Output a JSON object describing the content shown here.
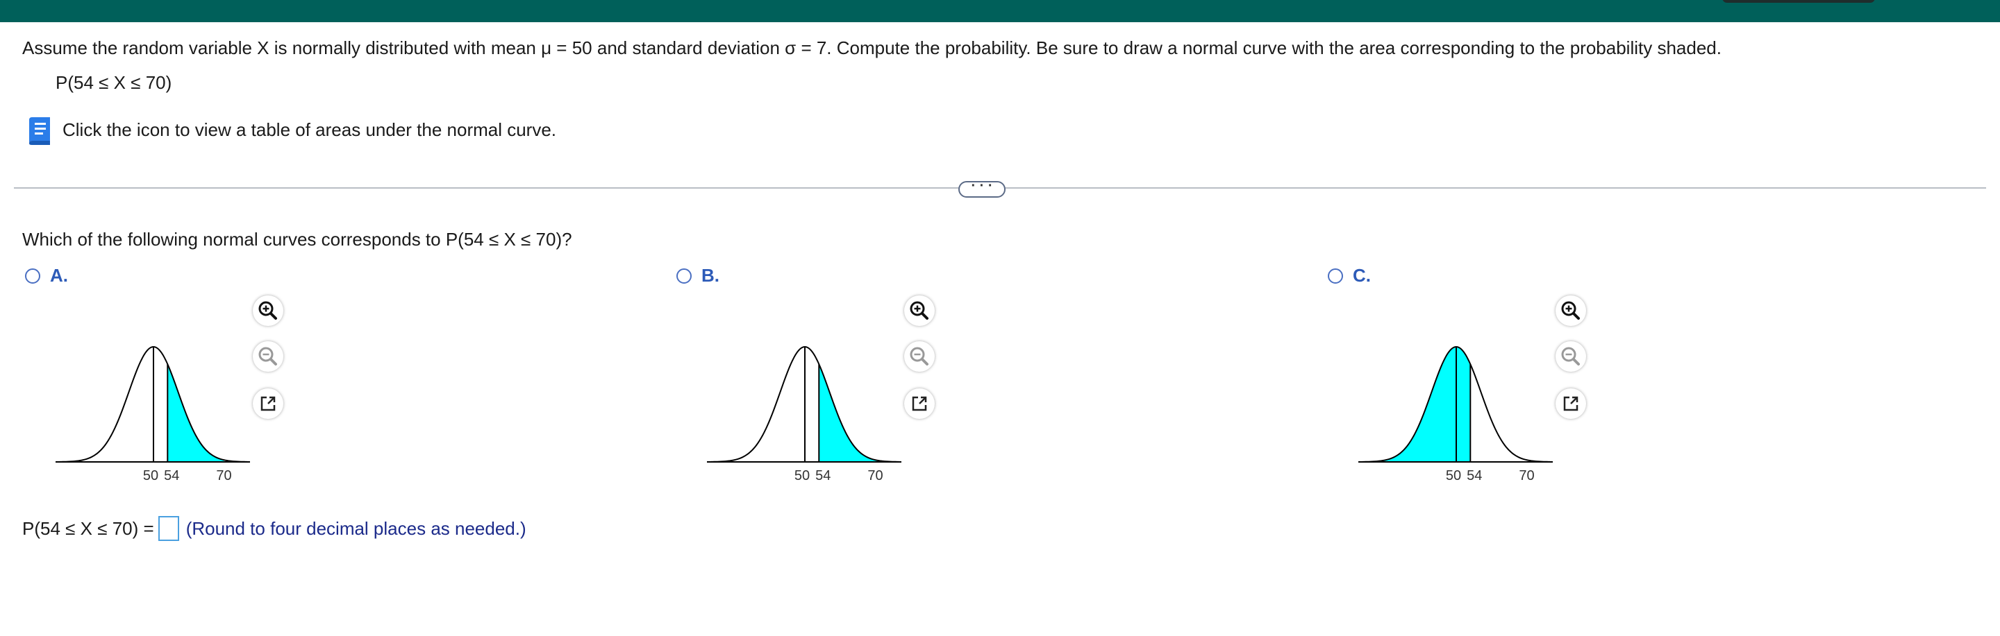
{
  "question": {
    "text": "Assume the random variable X is normally distributed with mean μ = 50 and standard deviation σ = 7. Compute the probability. Be sure to draw a normal curve with the area corresponding to the probability shaded.",
    "given": "P(54 ≤ X ≤ 70)",
    "table_link_text": "Click the icon to view a table of areas under the normal curve."
  },
  "more_button": "· · ·",
  "prompt": "Which of the following normal curves corresponds to P(54 ≤ X ≤ 70)?",
  "options": [
    {
      "label": "A.",
      "shaded_range": [
        54,
        70
      ],
      "tick_labels": [
        "50",
        "54",
        "70"
      ]
    },
    {
      "label": "B.",
      "shaded_range": [
        54,
        "right tail"
      ],
      "tick_labels": [
        "50",
        "54",
        "70"
      ]
    },
    {
      "label": "C.",
      "shaded_range": [
        "left tail",
        54
      ],
      "tick_labels": [
        "50",
        "54",
        "70"
      ]
    }
  ],
  "answer": {
    "lhs": "P(54 ≤ X ≤ 70) =",
    "value": "",
    "note": "(Round to four decimal places as needed.)"
  },
  "colors": {
    "topbar": "#00605a",
    "shade": "#00ffff",
    "link_blue": "#2d5bb8",
    "note_blue": "#1b2a8a"
  },
  "icons": [
    "book-icon",
    "zoom-in-icon",
    "zoom-out-icon",
    "popout-icon"
  ]
}
